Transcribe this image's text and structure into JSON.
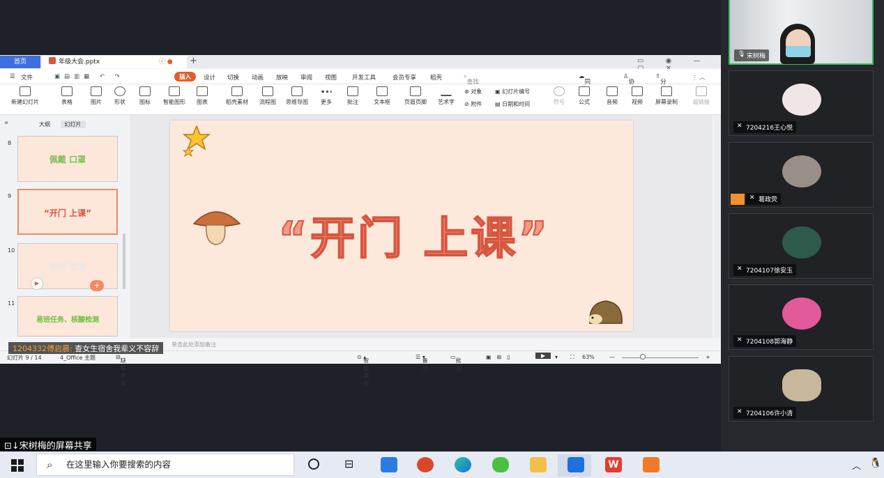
{
  "tabs": {
    "home": "首页",
    "file": "年级大会.pptx"
  },
  "menu": {
    "file": "文件",
    "items": [
      "插入",
      "设计",
      "切换",
      "动画",
      "放映",
      "审阅",
      "视图",
      "开发工具",
      "会员专享",
      "稻壳"
    ],
    "search_placeholder": "查找命令、搜索模板",
    "sync": "同步异常",
    "collab": "协作",
    "share": "分享"
  },
  "ribbon": {
    "buttons": [
      "新建幻灯片",
      "表格",
      "图片",
      "形状",
      "图标",
      "智能图形",
      "图表",
      "稻壳素材",
      "流程图",
      "思维导图",
      "更多",
      "批注",
      "文本框",
      "页眉页脚",
      "艺术字"
    ],
    "small": [
      "对象",
      "幻灯片编号",
      "附件",
      "日期和时间"
    ],
    "right": [
      "符号",
      "公式",
      "音频",
      "视频",
      "屏幕录制",
      "超链接"
    ]
  },
  "side_panel": {
    "tabs": [
      "大纲",
      "幻灯片"
    ],
    "thumbs": [
      {
        "num": "8",
        "text": "佩戴 口罩",
        "color": "#7fbf55"
      },
      {
        "num": "9",
        "text": "“开门 上课”",
        "color": "#d8563e"
      },
      {
        "num": "10",
        "text": "回归 教室",
        "color": "#e8e8e8"
      },
      {
        "num": "11",
        "text": "易班任务、核酸检测",
        "color": "#6cbf3a"
      }
    ]
  },
  "slide": {
    "title": "“开门 上课”"
  },
  "notes_placeholder": "单击此处添加备注",
  "status": {
    "slide_num": "幻灯片 9 / 14",
    "theme": "4_Office 主题",
    "font": "缺失字体",
    "beautify": "智能美化",
    "notes": "备注",
    "comments": "批注",
    "zoom": "63%"
  },
  "danmaku": {
    "user": "1204332傅启晨:",
    "text": "查女生宿舍我辈义不容辞"
  },
  "participants": [
    {
      "name": "宋树梅",
      "avatar_color": "#c9d3da"
    },
    {
      "name": "7204216王心悦",
      "avatar_color": "#f1e6e6"
    },
    {
      "name": "葛政荧",
      "avatar_color": "#9a8f86"
    },
    {
      "name": "7204107徐安玉",
      "avatar_color": "#2e5a4c"
    },
    {
      "name": "7204108郭海静",
      "avatar_color": "#e25a9a"
    },
    {
      "name": "7204106许小清",
      "avatar_color": "#c7b79c"
    }
  ],
  "screen_share_label": "宋树梅的屏幕共享",
  "taskbar": {
    "search_placeholder": "在这里输入你要搜索的内容"
  }
}
